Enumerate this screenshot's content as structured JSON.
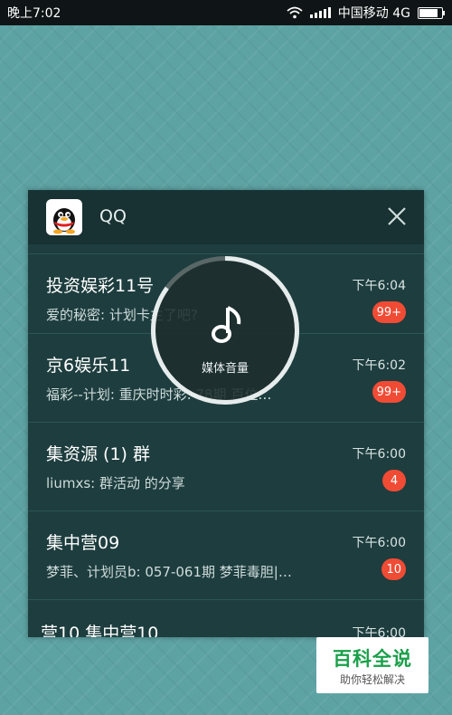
{
  "status_bar": {
    "time": "晚上7:02",
    "carrier": "中国移动 4G",
    "battery_level": 0.85
  },
  "notification": {
    "app_name": "QQ",
    "messages": [
      {
        "name": "投资娱彩11号",
        "preview": "爱的秘密: 计划卡主了吧?",
        "time": "下午6:04",
        "badge": "99+"
      },
      {
        "name": "京6娱乐11",
        "preview": "福彩--计划: 重庆时时彩: 78期   百位…",
        "time": "下午6:02",
        "badge": "99+"
      },
      {
        "name": "集资源 (1) 群",
        "preview": "liumxs: 群活动 的分享",
        "time": "下午6:00",
        "badge": "4"
      },
      {
        "name": "集中营09",
        "preview": "梦菲、计划员b: 057-061期 梦菲毒胆|…",
        "time": "下午6:00",
        "badge": "10"
      },
      {
        "name": "营10 集中营10",
        "preview": "",
        "time": "下午6:00",
        "badge": ""
      }
    ]
  },
  "volume_overlay": {
    "label": "媒体音量",
    "icon": "music-note-icon",
    "level": 0.85
  },
  "watermark": {
    "title": "百科全说",
    "subtitle": "助你轻松解决"
  },
  "colors": {
    "badge": "#f04b34",
    "panel": "#1e3d3e",
    "wallpaper": "#5ea3a4"
  }
}
